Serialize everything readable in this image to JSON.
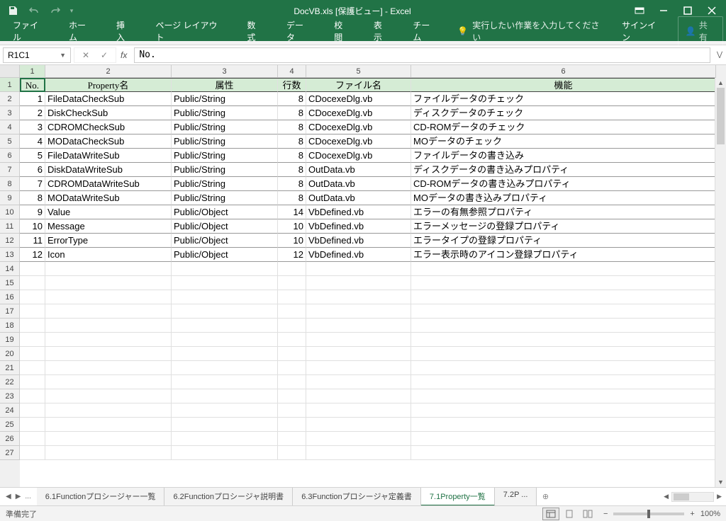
{
  "title": "DocVB.xls  [保護ビュー] - Excel",
  "tabs": [
    "ファイル",
    "ホーム",
    "挿入",
    "ページ レイアウト",
    "数式",
    "データ",
    "校閲",
    "表示",
    "チーム"
  ],
  "tellMe": "実行したい作業を入力してください",
  "signin": "サインイン",
  "share": "共有",
  "nameBox": "R1C1",
  "formula": "No.",
  "colHeaders": [
    "1",
    "2",
    "3",
    "4",
    "5",
    "6"
  ],
  "headers": {
    "no": "No.",
    "prop": "Property名",
    "attr": "属性",
    "lines": "行数",
    "file": "ファイル名",
    "func": "機能"
  },
  "rows": [
    {
      "no": 1,
      "prop": "FileDataCheckSub",
      "attr": "Public/String",
      "lines": 8,
      "file": "CDocexeDlg.vb",
      "func": "ファイルデータのチェック"
    },
    {
      "no": 2,
      "prop": "DiskCheckSub",
      "attr": "Public/String",
      "lines": 8,
      "file": "CDocexeDlg.vb",
      "func": "ディスクデータのチェック"
    },
    {
      "no": 3,
      "prop": "CDROMCheckSub",
      "attr": "Public/String",
      "lines": 8,
      "file": "CDocexeDlg.vb",
      "func": "CD-ROMデータのチェック"
    },
    {
      "no": 4,
      "prop": "MODataCheckSub",
      "attr": "Public/String",
      "lines": 8,
      "file": "CDocexeDlg.vb",
      "func": "MOデータのチェック"
    },
    {
      "no": 5,
      "prop": "FileDataWriteSub",
      "attr": "Public/String",
      "lines": 8,
      "file": "CDocexeDlg.vb",
      "func": "ファイルデータの書き込み"
    },
    {
      "no": 6,
      "prop": "DiskDataWriteSub",
      "attr": "Public/String",
      "lines": 8,
      "file": "OutData.vb",
      "func": "ディスクデータの書き込みプロパティ"
    },
    {
      "no": 7,
      "prop": "CDROMDataWriteSub",
      "attr": "Public/String",
      "lines": 8,
      "file": "OutData.vb",
      "func": "CD-ROMデータの書き込みプロパティ"
    },
    {
      "no": 8,
      "prop": "MODataWriteSub",
      "attr": "Public/String",
      "lines": 8,
      "file": "OutData.vb",
      "func": "MOデータの書き込みプロパティ"
    },
    {
      "no": 9,
      "prop": "Value",
      "attr": "Public/Object",
      "lines": 14,
      "file": "VbDefined.vb",
      "func": "エラーの有無参照プロパティ"
    },
    {
      "no": 10,
      "prop": "Message",
      "attr": "Public/Object",
      "lines": 10,
      "file": "VbDefined.vb",
      "func": "エラーメッセージの登録プロパティ"
    },
    {
      "no": 11,
      "prop": "ErrorType",
      "attr": "Public/Object",
      "lines": 10,
      "file": "VbDefined.vb",
      "func": "エラータイプの登録プロパティ"
    },
    {
      "no": 12,
      "prop": "Icon",
      "attr": "Public/Object",
      "lines": 12,
      "file": "VbDefined.vb",
      "func": "エラー表示時のアイコン登録プロパティ"
    }
  ],
  "emptyRows": 14,
  "sheetTabs": [
    {
      "label": "6.1Functionプロシージャー一覧",
      "active": false
    },
    {
      "label": "6.2Functionプロシージャ説明書",
      "active": false
    },
    {
      "label": "6.3Functionプロシージャ定義書",
      "active": false
    },
    {
      "label": "7.1Property一覧",
      "active": true
    },
    {
      "label": "7.2P ...",
      "active": false
    }
  ],
  "status": "準備完了",
  "zoom": "100%"
}
